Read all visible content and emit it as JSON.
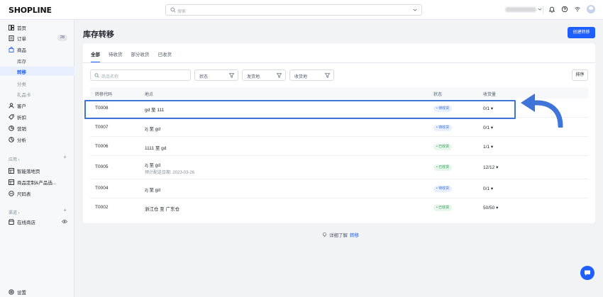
{
  "app": {
    "logo": "SHOPLINE",
    "search_placeholder": "搜索",
    "store_name": "Flash Store"
  },
  "sidebar": {
    "items": [
      {
        "label": "首页",
        "icon": "home-icon"
      },
      {
        "label": "订单",
        "icon": "order-icon",
        "badge": "28"
      },
      {
        "label": "商品",
        "icon": "bag-icon"
      },
      {
        "label": "库存"
      },
      {
        "label": "转移"
      },
      {
        "label": "分类"
      },
      {
        "label": "礼品卡"
      },
      {
        "label": "客户",
        "icon": "user-icon"
      },
      {
        "label": "折扣",
        "icon": "tag-icon"
      },
      {
        "label": "营销",
        "icon": "megaphone-icon"
      },
      {
        "label": "分析",
        "icon": "chart-icon"
      }
    ],
    "apps_group": "应用",
    "apps": [
      {
        "label": "智能落地页",
        "icon": "grid-icon"
      },
      {
        "label": "商品定制&产品选...",
        "icon": "grid-icon"
      },
      {
        "label": "尺码表",
        "icon": "ruler-icon"
      }
    ],
    "channels_group": "渠道",
    "channels": [
      {
        "label": "在线商店",
        "icon": "store-icon"
      }
    ],
    "settings": "设置"
  },
  "page": {
    "title": "库存转移",
    "create_button": "创建转移",
    "tabs": [
      "全部",
      "待收货",
      "部分收货",
      "已收货"
    ],
    "filters": {
      "search_placeholder": "商品名称",
      "status": "状态",
      "origin": "发货地",
      "destination": "收货地",
      "sort": "排序"
    },
    "table": {
      "headers": [
        "转移代码",
        "地点",
        "状态",
        "收货量"
      ],
      "rows": [
        {
          "code": "T0008",
          "location": "gd 至 111",
          "status": "待收货",
          "status_type": "pending",
          "qty": "0/1"
        },
        {
          "code": "T0007",
          "location": "zj 至 gd",
          "status": "待收货",
          "status_type": "pending",
          "qty": "0/1"
        },
        {
          "code": "T0006",
          "location": "1111 至 gd",
          "status": "已收货",
          "status_type": "done",
          "qty": "1/1"
        },
        {
          "code": "T0005",
          "location": "zj 至 gd",
          "sub": "预计配送日期: 2023-03-26",
          "status": "已收货",
          "status_type": "done",
          "qty": "12/12"
        },
        {
          "code": "T0004",
          "location": "zj 至 gd",
          "status": "待收货",
          "status_type": "pending",
          "qty": "0/1"
        },
        {
          "code": "T0002",
          "location": "浙江仓 至 广东仓",
          "status": "已收货",
          "status_type": "done",
          "qty": "50/50"
        }
      ]
    },
    "footer": {
      "text": "详细了解",
      "link": "转移"
    }
  },
  "colors": {
    "accent": "#1f5fff",
    "highlight": "#3f74d9",
    "pending_bg": "#e8f0ff",
    "done_bg": "#e6f7ec"
  }
}
